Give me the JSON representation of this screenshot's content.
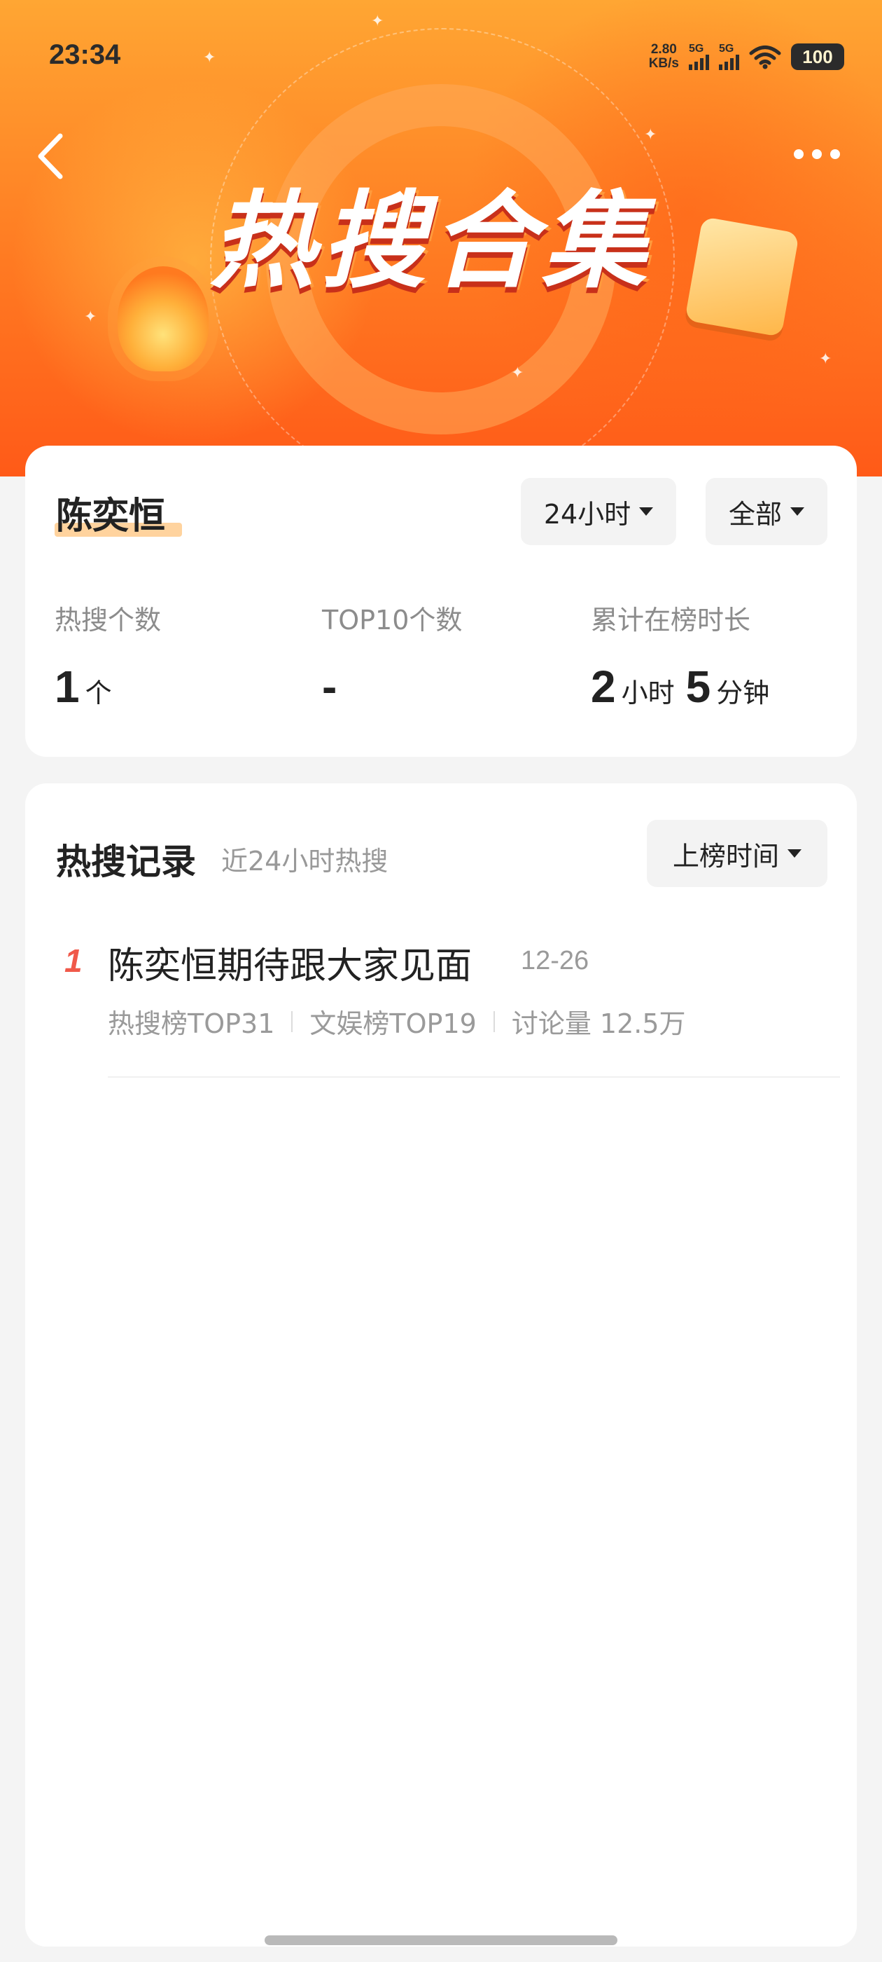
{
  "status_bar": {
    "time": "23:34",
    "net_speed_value": "2.80",
    "net_speed_unit": "KB/s",
    "signal1_label": "5G",
    "signal2_label": "5G",
    "battery": "100"
  },
  "banner": {
    "title": "热搜合集",
    "back_icon": "chevron-left-icon",
    "more_icon": "more-dots-icon"
  },
  "summary": {
    "person": "陈奕恒",
    "time_filter": "24小时",
    "scope_filter": "全部",
    "stats": [
      {
        "label": "热搜个数",
        "value": "1",
        "unit": "个"
      },
      {
        "label": "TOP10个数",
        "value": "-",
        "unit": ""
      },
      {
        "label": "累计在榜时长",
        "value1": "2",
        "unit1": "小时",
        "value2": "5",
        "unit2": "分钟"
      }
    ]
  },
  "records": {
    "title": "热搜记录",
    "subtitle": "近24小时热搜",
    "sort_label": "上榜时间",
    "items": [
      {
        "rank": "1",
        "topic": "陈奕恒期待跟大家见面",
        "date": "12-26",
        "meta": [
          "热搜榜TOP31",
          "文娱榜TOP19",
          "讨论量 12.5万"
        ]
      }
    ]
  },
  "colors": {
    "accent": "#ff7a22",
    "rank": "#f0594a",
    "highlight": "#ffd39e"
  }
}
